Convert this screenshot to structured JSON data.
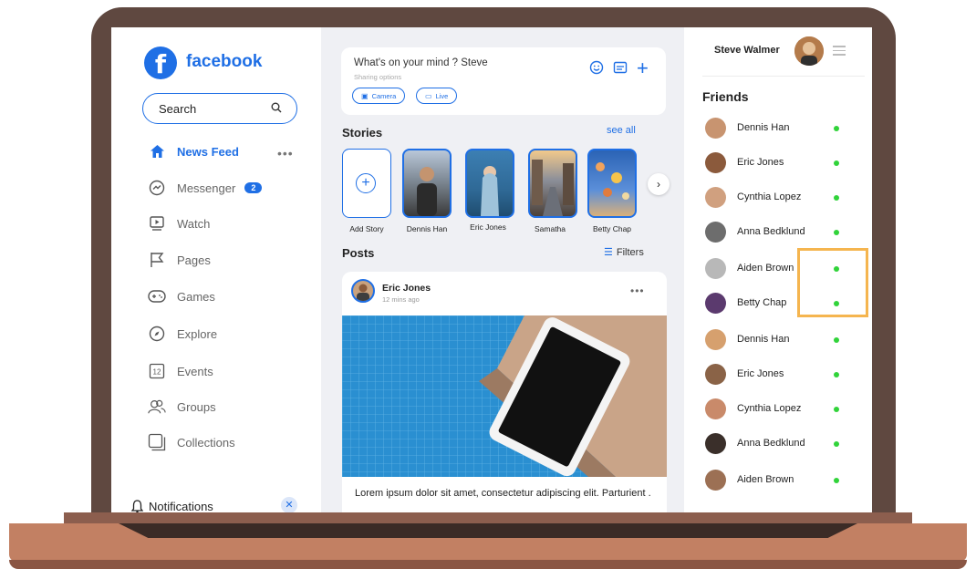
{
  "app": {
    "brand": "facebook",
    "accent_color": "#1f6fe5",
    "online_color": "#31d33a"
  },
  "sidebar": {
    "search_label": "Search",
    "items": [
      {
        "label": "News Feed",
        "icon": "home-icon"
      },
      {
        "label": "Messenger",
        "icon": "messenger-icon",
        "badge": "2"
      },
      {
        "label": "Watch",
        "icon": "watch-icon"
      },
      {
        "label": "Pages",
        "icon": "flag-icon"
      },
      {
        "label": "Games",
        "icon": "gamepad-icon"
      },
      {
        "label": "Explore",
        "icon": "compass-icon"
      },
      {
        "label": "Events",
        "icon": "calendar-icon",
        "icon_text": "12"
      },
      {
        "label": "Groups",
        "icon": "groups-icon"
      },
      {
        "label": "Collections",
        "icon": "collections-icon"
      }
    ],
    "notifications_label": "Notifications"
  },
  "composer": {
    "prompt": "What's on your mind ? Steve",
    "sub": "Sharing options",
    "camera_label": "Camera",
    "live_label": "Live"
  },
  "stories": {
    "title": "Stories",
    "see_all": "see all",
    "add_label": "Add Story",
    "items": [
      {
        "name": "Dennis Han"
      },
      {
        "name": "Eric Jones"
      },
      {
        "name": "Samatha"
      },
      {
        "name": "Betty Chap"
      }
    ]
  },
  "posts": {
    "title": "Posts",
    "filters_label": "Filters",
    "post": {
      "author": "Eric Jones",
      "time": "12 mins ago",
      "text": "Lorem ipsum dolor sit amet, consectetur adipiscing elit. Parturient ."
    }
  },
  "user": {
    "name": "Steve Walmer"
  },
  "friends": {
    "title": "Friends",
    "list": [
      {
        "name": "Dennis Han",
        "online": true
      },
      {
        "name": "Eric Jones",
        "online": true
      },
      {
        "name": "Cynthia Lopez",
        "online": true
      },
      {
        "name": "Anna Bedklund",
        "online": true
      },
      {
        "name": "Aiden Brown",
        "online": true
      },
      {
        "name": "Betty Chap",
        "online": true
      },
      {
        "name": "Dennis Han",
        "online": true
      },
      {
        "name": "Eric Jones",
        "online": true
      },
      {
        "name": "Cynthia Lopez",
        "online": true
      },
      {
        "name": "Anna Bedklund",
        "online": true
      },
      {
        "name": "Aiden Brown",
        "online": true
      }
    ]
  }
}
